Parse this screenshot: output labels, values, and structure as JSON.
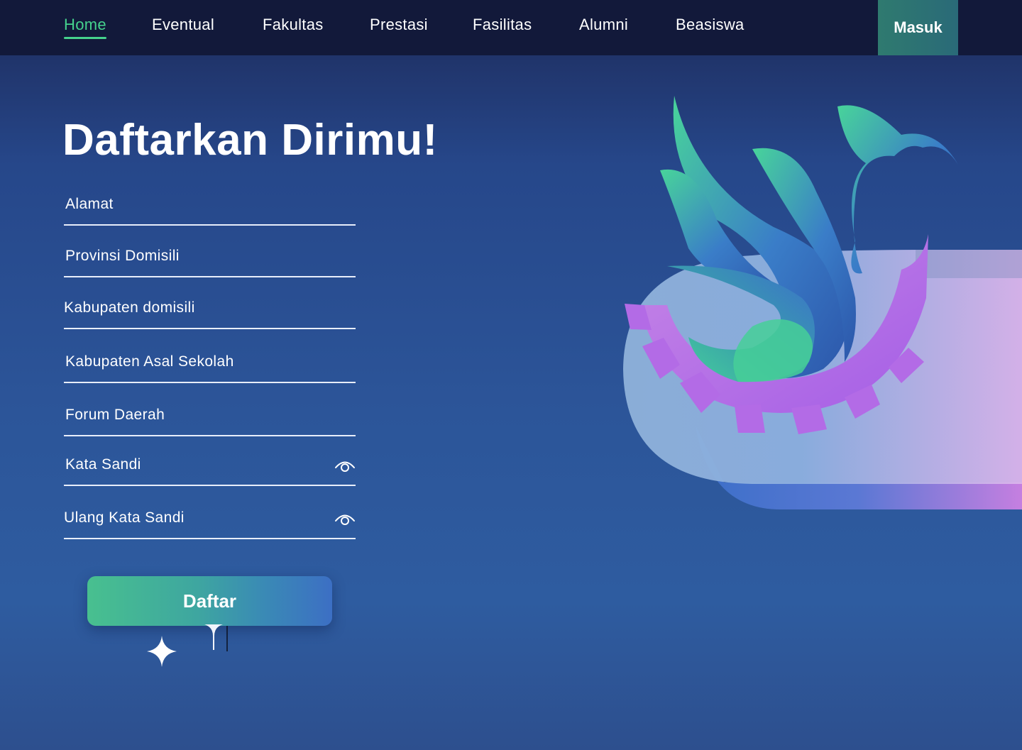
{
  "nav": {
    "items": [
      {
        "label": "Home",
        "active": true
      },
      {
        "label": "Eventual",
        "active": false
      },
      {
        "label": "Fakultas",
        "active": false
      },
      {
        "label": "Prestasi",
        "active": false
      },
      {
        "label": "Fasilitas",
        "active": false
      },
      {
        "label": "Alumni",
        "active": false
      },
      {
        "label": "Beasiswa",
        "active": false
      }
    ],
    "login_label": "Masuk"
  },
  "form": {
    "title": "Daftarkan Dirimu!",
    "fields": [
      {
        "label": "Alamat"
      },
      {
        "label": "Provinsi Domisili"
      },
      {
        "label": "Kabupaten domisili"
      },
      {
        "label": "Kabupaten Asal Sekolah"
      },
      {
        "label": "Forum Daerah"
      },
      {
        "label": "Kata Sandi",
        "icon": "eye-icon"
      },
      {
        "label": "Ulang Kata Sandi",
        "icon": "eye-icon"
      }
    ],
    "submit_label": "Daftar"
  },
  "colors": {
    "accent_green": "#45d28d",
    "nav_bg": "#12193a",
    "background": "#2c5599",
    "phoenix_purple": "#b86ae6"
  }
}
